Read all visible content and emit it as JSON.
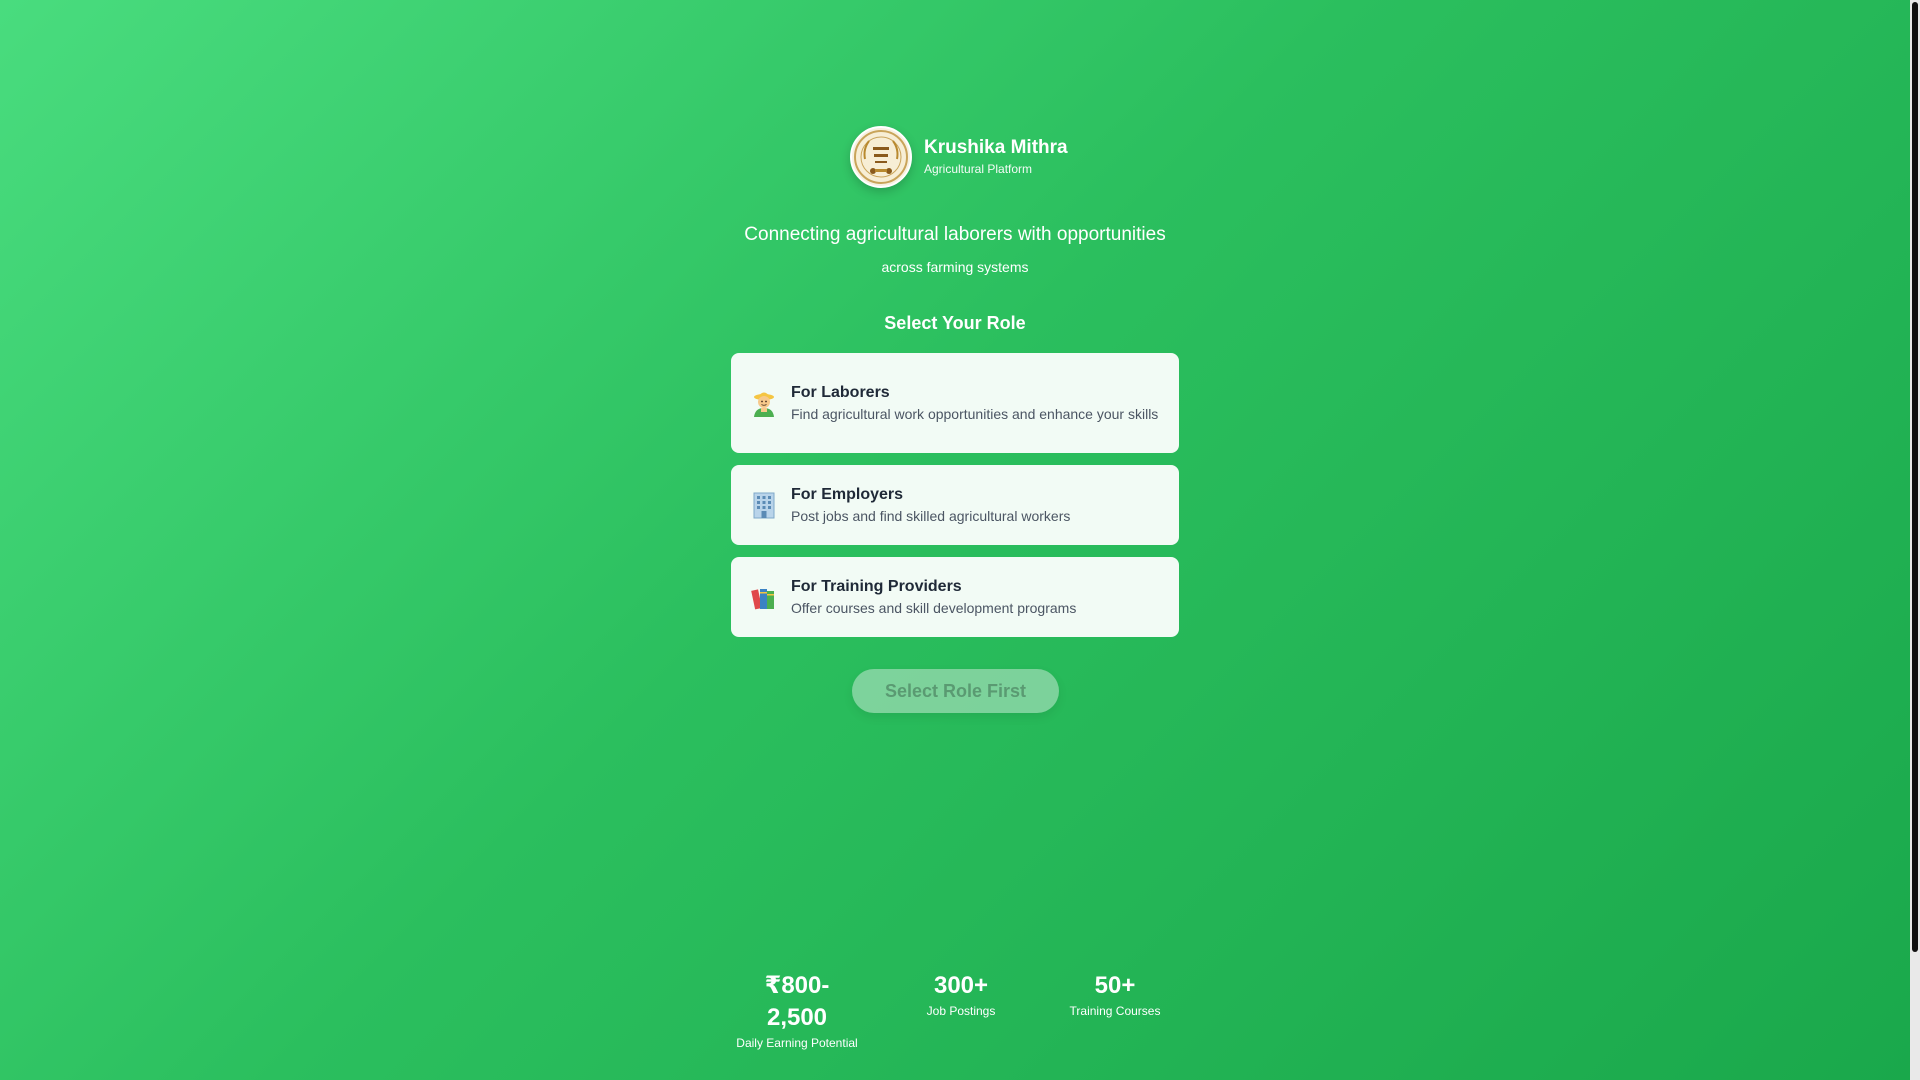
{
  "brand": {
    "title": "Krushika Mithra",
    "subtitle": "Agricultural Platform",
    "logo_icon": "krushika-mithra-logo"
  },
  "hero": {
    "tagline": "Connecting agricultural laborers with opportunities",
    "tagline_sub": "across farming systems"
  },
  "roles_section": {
    "title": "Select Your Role",
    "items": [
      {
        "icon": "farmer-icon",
        "title": "For Laborers",
        "description": "Find agricultural work opportunities and enhance your skills"
      },
      {
        "icon": "office-building-icon",
        "title": "For Employers",
        "description": "Post jobs and find skilled agricultural workers"
      },
      {
        "icon": "books-icon",
        "title": "For Training Providers",
        "description": "Offer courses and skill development programs"
      }
    ]
  },
  "action": {
    "button_label": "Select Role First",
    "disabled": true
  },
  "stats": [
    {
      "value": "₹800-\n2,500",
      "value_line1": "₹800-",
      "value_line2": "2,500",
      "label": "Daily Earning Potential"
    },
    {
      "value": "300+",
      "label": "Job Postings"
    },
    {
      "value": "50+",
      "label": "Training Courses"
    }
  ],
  "colors": {
    "background_start": "#49dc7e",
    "background_end": "#1aa84b",
    "card_background": "#f2fbf5",
    "button_disabled_bg": "#aadebe",
    "button_disabled_text": "#5a9a72"
  }
}
